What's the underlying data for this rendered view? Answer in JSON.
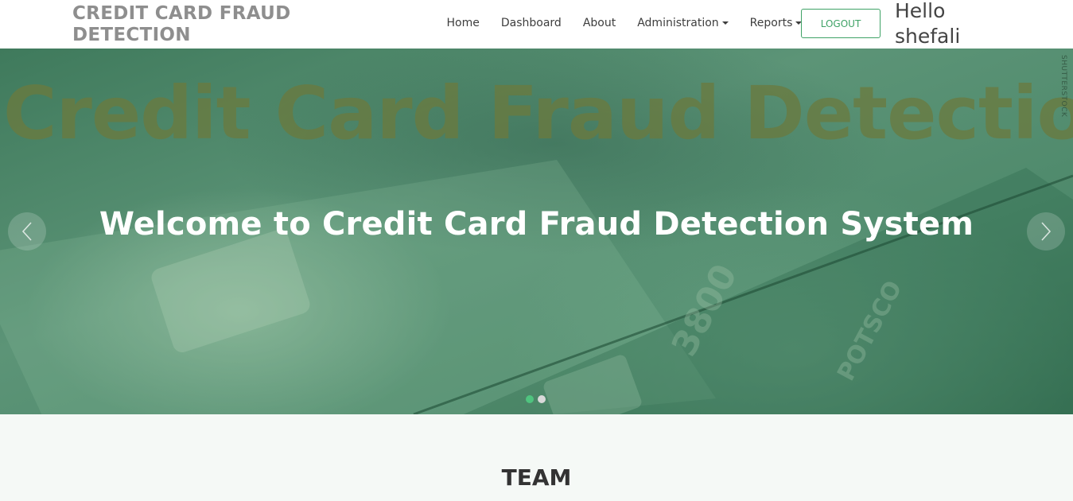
{
  "navbar": {
    "brand": "CREDIT CARD FRAUD DETECTION",
    "links": [
      {
        "label": "Home",
        "dropdown": false
      },
      {
        "label": "Dashboard",
        "dropdown": false
      },
      {
        "label": "About",
        "dropdown": false
      },
      {
        "label": "Administration",
        "dropdown": true
      },
      {
        "label": "Reports",
        "dropdown": true
      }
    ],
    "logout_label": "LOGOUT",
    "greeting": "Hello shefali"
  },
  "hero": {
    "background_title": "Credit Card Fraud Detection",
    "watermark": "SHUTTERSTOCK",
    "heading": "Welcome to Credit Card Fraud Detection System",
    "prev_icon": "chevron-left-icon",
    "next_icon": "chevron-right-icon",
    "slides_count": 2,
    "active_slide": 1
  },
  "team": {
    "title": "TEAM"
  },
  "colors": {
    "accent": "#3fa266",
    "brand_text": "#8e8e8e",
    "hero_overlay": "#4f8a6c",
    "section_bg": "#f5f9f6",
    "dot_active": "#4fc47f",
    "dot_inactive": "#d9d9d9"
  }
}
